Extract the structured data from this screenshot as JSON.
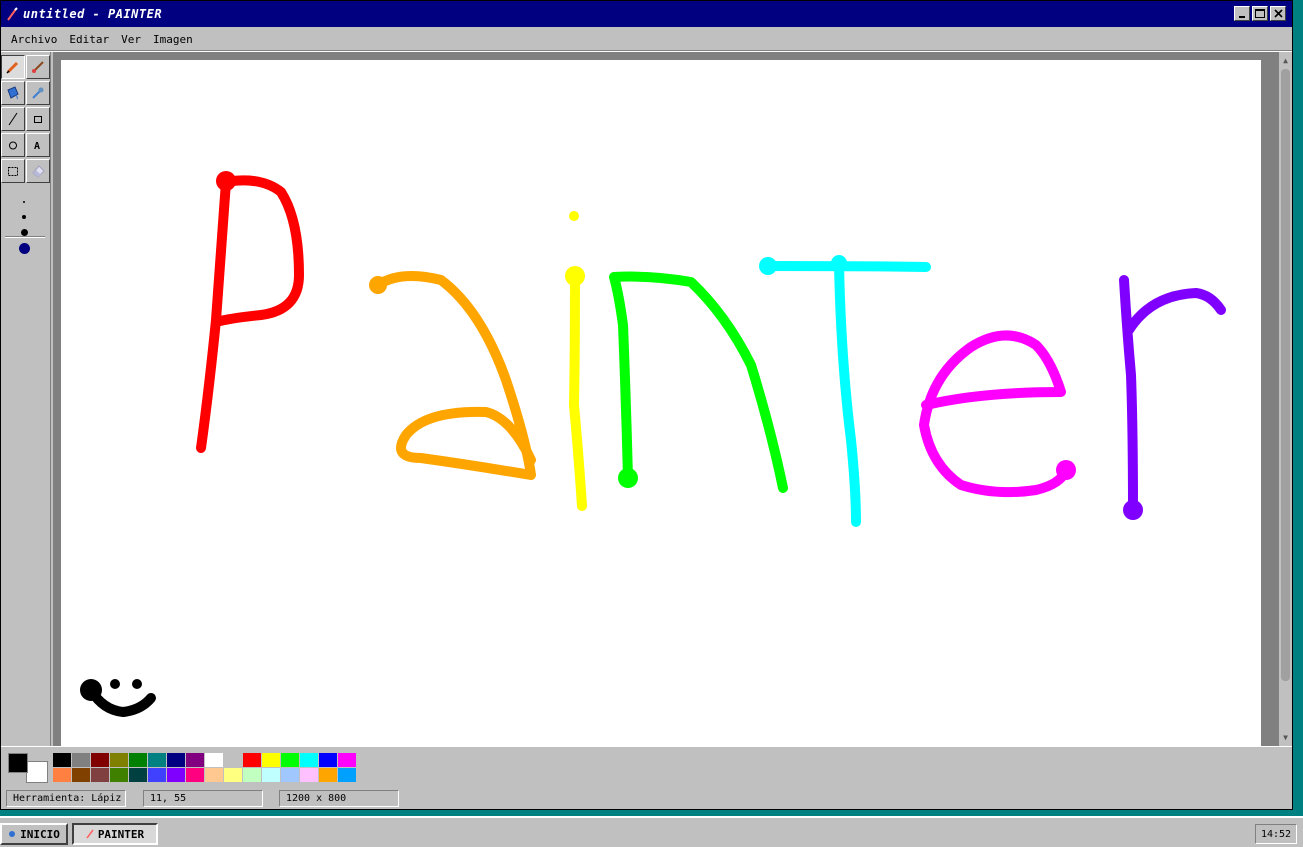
{
  "window": {
    "title": "untitled - PAINTER"
  },
  "menu": [
    "Archivo",
    "Editar",
    "Ver",
    "Imagen"
  ],
  "toolbox": {
    "tools": [
      {
        "name": "pencil-tool",
        "icon": "pencil-icon",
        "active": true
      },
      {
        "name": "brush-tool",
        "icon": "brush-icon",
        "active": false
      },
      {
        "name": "fill-tool",
        "icon": "bucket-icon",
        "active": false
      },
      {
        "name": "picker-tool",
        "icon": "eyedropper-icon",
        "active": false
      },
      {
        "name": "line-tool",
        "icon": "line-icon",
        "label": "/"
      },
      {
        "name": "rect-tool",
        "icon": "rectangle-icon",
        "label": "□"
      },
      {
        "name": "ellipse-tool",
        "icon": "ellipse-icon",
        "label": "○"
      },
      {
        "name": "text-tool",
        "icon": "text-icon",
        "label": "A"
      },
      {
        "name": "select-tool",
        "icon": "select-icon",
        "label": "⬚"
      },
      {
        "name": "eraser-tool",
        "icon": "eraser-icon"
      }
    ],
    "brush_sizes": [
      "size-1",
      "size-2",
      "size-3",
      "size-4"
    ]
  },
  "colors": {
    "foreground": "#000000",
    "background": "#ffffff",
    "palette_row1": [
      "#000000",
      "#808080",
      "#800000",
      "#808000",
      "#008000",
      "#008080",
      "#000080",
      "#800080",
      "#ffffff",
      "#c0c0c0",
      "#ff0000",
      "#ffff00",
      "#00ff00",
      "#00ffff",
      "#0000ff",
      "#ff00ff"
    ],
    "palette_row2": [
      "#ff8040",
      "#804000",
      "#804040",
      "#408000",
      "#004040",
      "#4040ff",
      "#8000ff",
      "#ff0080",
      "#ffc890",
      "#ffff80",
      "#c0ffc0",
      "#c0ffff",
      "#a0c8ff",
      "#ffc0ff",
      "#ffa500",
      "#00a0ff"
    ]
  },
  "status": {
    "tool": "Herramienta: Lápiz",
    "coords": "11, 55",
    "size": "1200 x 800"
  },
  "taskbar": {
    "start": "INICIO",
    "task": "PAINTER",
    "clock": "14:52"
  }
}
